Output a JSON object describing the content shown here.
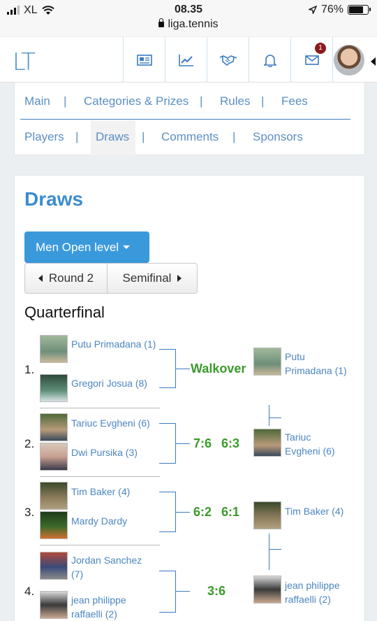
{
  "status_bar": {
    "carrier": "XL",
    "time": "08.35",
    "battery": "76%",
    "battery_level": 0.76,
    "url": "liga.tennis"
  },
  "header": {
    "logo": "LT",
    "notification_count": "1"
  },
  "tabs": {
    "row1": [
      "Main",
      "Categories & Prizes",
      "Rules",
      "Fees"
    ],
    "row2": [
      "Players",
      "Draws",
      "Comments",
      "Sponsors"
    ],
    "separator": "|",
    "active": "Draws"
  },
  "page": {
    "title": "Draws",
    "category_dropdown": "Men Open level",
    "round_prev": "Round 2",
    "round_next": "Semifinal",
    "round_title": "Quarterfinal"
  },
  "matches": [
    {
      "number": "1.",
      "player1": "Putu Primadana (1)",
      "player2": "Gregori Josua (8)",
      "score": [
        "Walkover"
      ],
      "winner": "Putu Primadana (1)"
    },
    {
      "number": "2.",
      "player1": "Tariuc Evgheni (6)",
      "player2": "Dwi Pursika (3)",
      "score": [
        "7:6",
        "6:3"
      ],
      "winner": "Tariuc Evgheni (6)"
    },
    {
      "number": "3.",
      "player1": "Tim Baker (4)",
      "player2": "Mardy Dardy",
      "score": [
        "6:2",
        "6:1"
      ],
      "winner": "Tim Baker (4)"
    },
    {
      "number": "4.",
      "player1": "Jordan Sanchez (7)",
      "player2": "jean philippe raffaelli (2)",
      "score": [
        "3:6"
      ],
      "winner": "jean philippe raffaelli (2)"
    }
  ],
  "colors": {
    "link": "#4b86c0",
    "accent": "#3a99db",
    "score": "#3a9a2a",
    "badge": "#8b1a1a"
  }
}
